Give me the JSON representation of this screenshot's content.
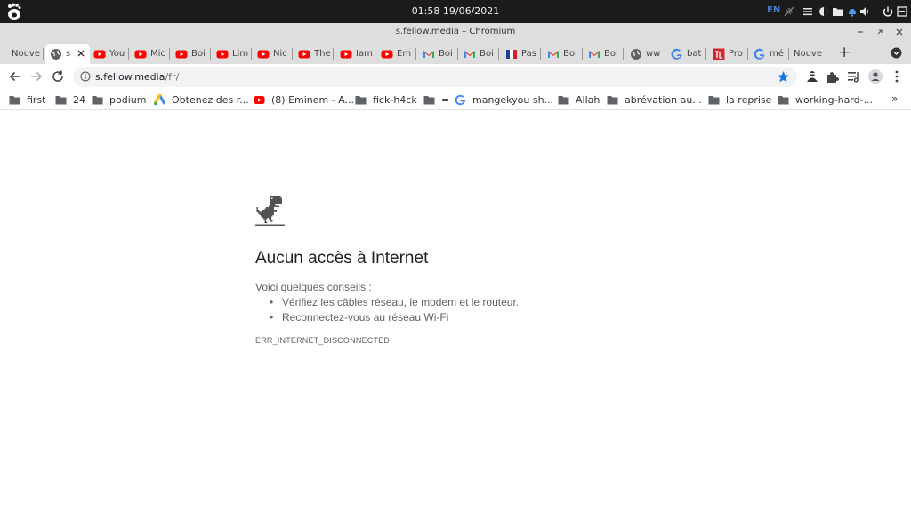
{
  "system_bar": {
    "clock": "01:58 19/06/2021",
    "language": "EN",
    "tray_icons": [
      "network-off-icon",
      "menu-icon",
      "night-light-icon",
      "folder-icon",
      "notification-bell-icon",
      "volume-icon",
      "power-icon"
    ]
  },
  "window": {
    "title": "s.fellow.media – Chromium"
  },
  "tabs": [
    {
      "label": "Nouve",
      "icon": "none"
    },
    {
      "label": "s",
      "icon": "globe-icon",
      "active": true
    },
    {
      "label": "You",
      "icon": "youtube-icon"
    },
    {
      "label": "Mic",
      "icon": "youtube-icon"
    },
    {
      "label": "Boi",
      "icon": "youtube-icon"
    },
    {
      "label": "Lim",
      "icon": "youtube-icon"
    },
    {
      "label": "Nic",
      "icon": "youtube-icon"
    },
    {
      "label": "The",
      "icon": "youtube-icon"
    },
    {
      "label": "Iam",
      "icon": "youtube-icon"
    },
    {
      "label": "Em",
      "icon": "youtube-icon"
    },
    {
      "label": "Boi",
      "icon": "gmail-icon"
    },
    {
      "label": "Boi",
      "icon": "gmail-icon"
    },
    {
      "label": "Pas",
      "icon": "flag-icon"
    },
    {
      "label": "Boi",
      "icon": "gmail-icon"
    },
    {
      "label": "Boi",
      "icon": "gmail-icon"
    },
    {
      "label": "ww",
      "icon": "globe-icon"
    },
    {
      "label": "bat",
      "icon": "google-icon"
    },
    {
      "label": "Pro",
      "icon": "tl-icon"
    },
    {
      "label": "mé",
      "icon": "google-icon"
    },
    {
      "label": "Nouve",
      "icon": "none"
    }
  ],
  "new_tab_label": "+",
  "omnibox": {
    "host": "s.fellow.media",
    "path": "/fr/"
  },
  "bookmarks": [
    {
      "label": "first",
      "icon": "folder-icon"
    },
    {
      "label": "24",
      "icon": "folder-icon"
    },
    {
      "label": "podium",
      "icon": "folder-icon"
    },
    {
      "label": "Obtenez des r...",
      "icon": "google-ads-icon"
    },
    {
      "label": "(8) Eminem - A...",
      "icon": "youtube-icon"
    },
    {
      "label": "fick-h4ck",
      "icon": "folder-icon"
    },
    {
      "label": "=",
      "icon": "folder-icon"
    },
    {
      "label": "mangekyou sh...",
      "icon": "google-icon"
    },
    {
      "label": "Allah",
      "icon": "folder-icon"
    },
    {
      "label": "abrévation au...",
      "icon": "folder-icon"
    },
    {
      "label": "la reprise",
      "icon": "folder-icon"
    },
    {
      "label": "working-hard-...",
      "icon": "folder-icon"
    }
  ],
  "bookmarks_more": "»",
  "error": {
    "title": "Aucun accès à Internet",
    "intro": "Voici quelques conseils :",
    "tips": [
      "Vérifiez les câbles réseau, le modem et le routeur.",
      "Reconnectez-vous au réseau Wi-Fi"
    ],
    "code": "ERR_INTERNET_DISCONNECTED"
  },
  "colors": {
    "star_blue": "#1a73e8",
    "youtube_red": "#ff0000",
    "text_dark": "#202124",
    "text_muted": "#5f6368"
  }
}
